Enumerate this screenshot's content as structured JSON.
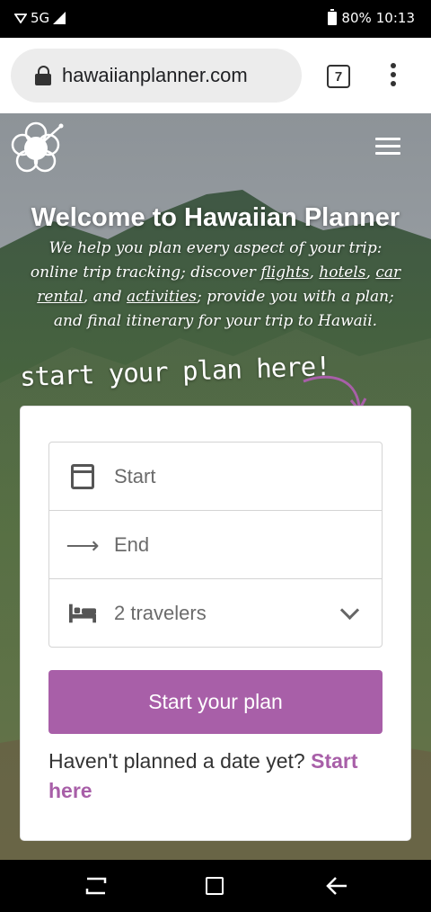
{
  "status_bar": {
    "network": "5G",
    "battery_percent": "80%",
    "time": "10:13"
  },
  "browser": {
    "url": "hawaiianplanner.com",
    "tab_count": "7"
  },
  "hero": {
    "title": "Welcome to Hawaiian Planner",
    "desc_part1": "We help you plan every aspect of your trip: online trip tracking; discover ",
    "link_flights": "flights",
    "sep1": ", ",
    "link_hotels": "hotels",
    "sep2": ", ",
    "link_car_rental": "car rental",
    "sep3": ", and ",
    "link_activities": "activities",
    "desc_part2": "; provide you with a plan; and final itinerary for your trip to Hawaii.",
    "script_text": "start your plan here!"
  },
  "form": {
    "start_placeholder": "Start",
    "end_placeholder": "End",
    "travelers_value": "2 travelers",
    "submit_label": "Start your plan",
    "no_date_text": "Haven't planned a date yet?",
    "no_date_link": "Start here"
  },
  "colors": {
    "accent": "#a85fa8"
  }
}
